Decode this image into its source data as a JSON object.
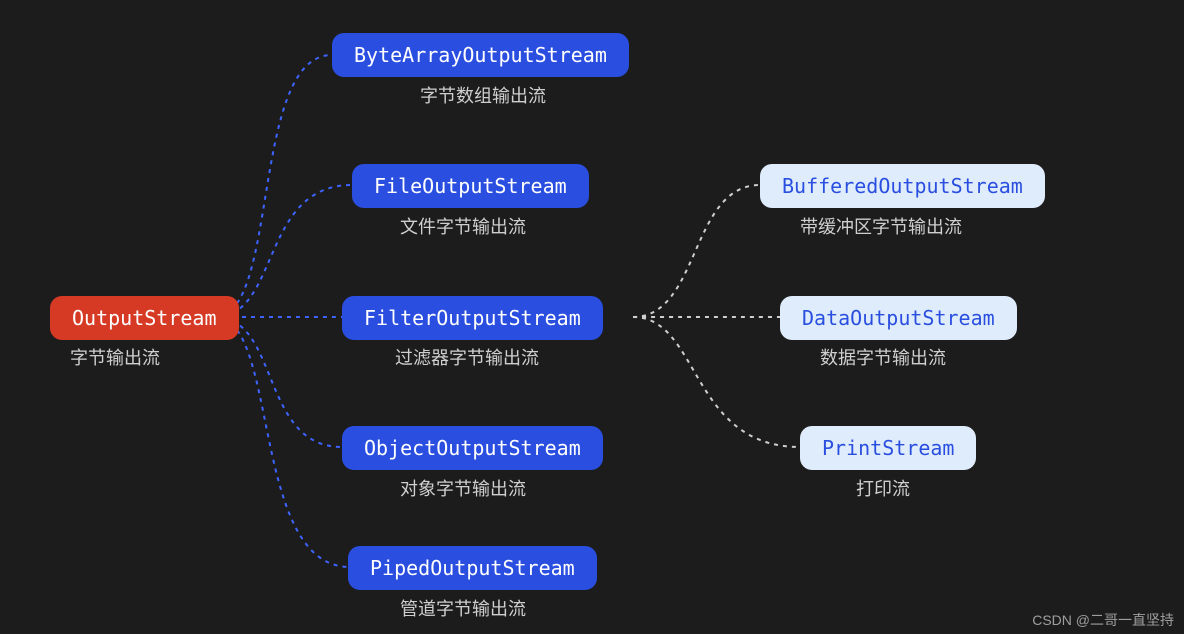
{
  "root": {
    "label": "OutputStream",
    "caption": "字节输出流"
  },
  "children": [
    {
      "label": "ByteArrayOutputStream",
      "caption": "字节数组输出流"
    },
    {
      "label": "FileOutputStream",
      "caption": "文件字节输出流"
    },
    {
      "label": "FilterOutputStream",
      "caption": "过滤器字节输出流"
    },
    {
      "label": "ObjectOutputStream",
      "caption": "对象字节输出流"
    },
    {
      "label": "PipedOutputStream",
      "caption": "管道字节输出流"
    }
  ],
  "filter_children": [
    {
      "label": "BufferedOutputStream",
      "caption": "带缓冲区字节输出流"
    },
    {
      "label": "DataOutputStream",
      "caption": "数据字节输出流"
    },
    {
      "label": "PrintStream",
      "caption": "打印流"
    }
  ],
  "watermark": "CSDN @二哥一直坚持",
  "chart_data": {
    "type": "tree",
    "root": "OutputStream",
    "edges": [
      [
        "OutputStream",
        "ByteArrayOutputStream"
      ],
      [
        "OutputStream",
        "FileOutputStream"
      ],
      [
        "OutputStream",
        "FilterOutputStream"
      ],
      [
        "OutputStream",
        "ObjectOutputStream"
      ],
      [
        "OutputStream",
        "PipedOutputStream"
      ],
      [
        "FilterOutputStream",
        "BufferedOutputStream"
      ],
      [
        "FilterOutputStream",
        "DataOutputStream"
      ],
      [
        "FilterOutputStream",
        "PrintStream"
      ]
    ],
    "node_meta": {
      "OutputStream": "字节输出流",
      "ByteArrayOutputStream": "字节数组输出流",
      "FileOutputStream": "文件字节输出流",
      "FilterOutputStream": "过滤器字节输出流",
      "ObjectOutputStream": "对象字节输出流",
      "PipedOutputStream": "管道字节输出流",
      "BufferedOutputStream": "带缓冲区字节输出流",
      "DataOutputStream": "数据字节输出流",
      "PrintStream": "打印流"
    }
  }
}
